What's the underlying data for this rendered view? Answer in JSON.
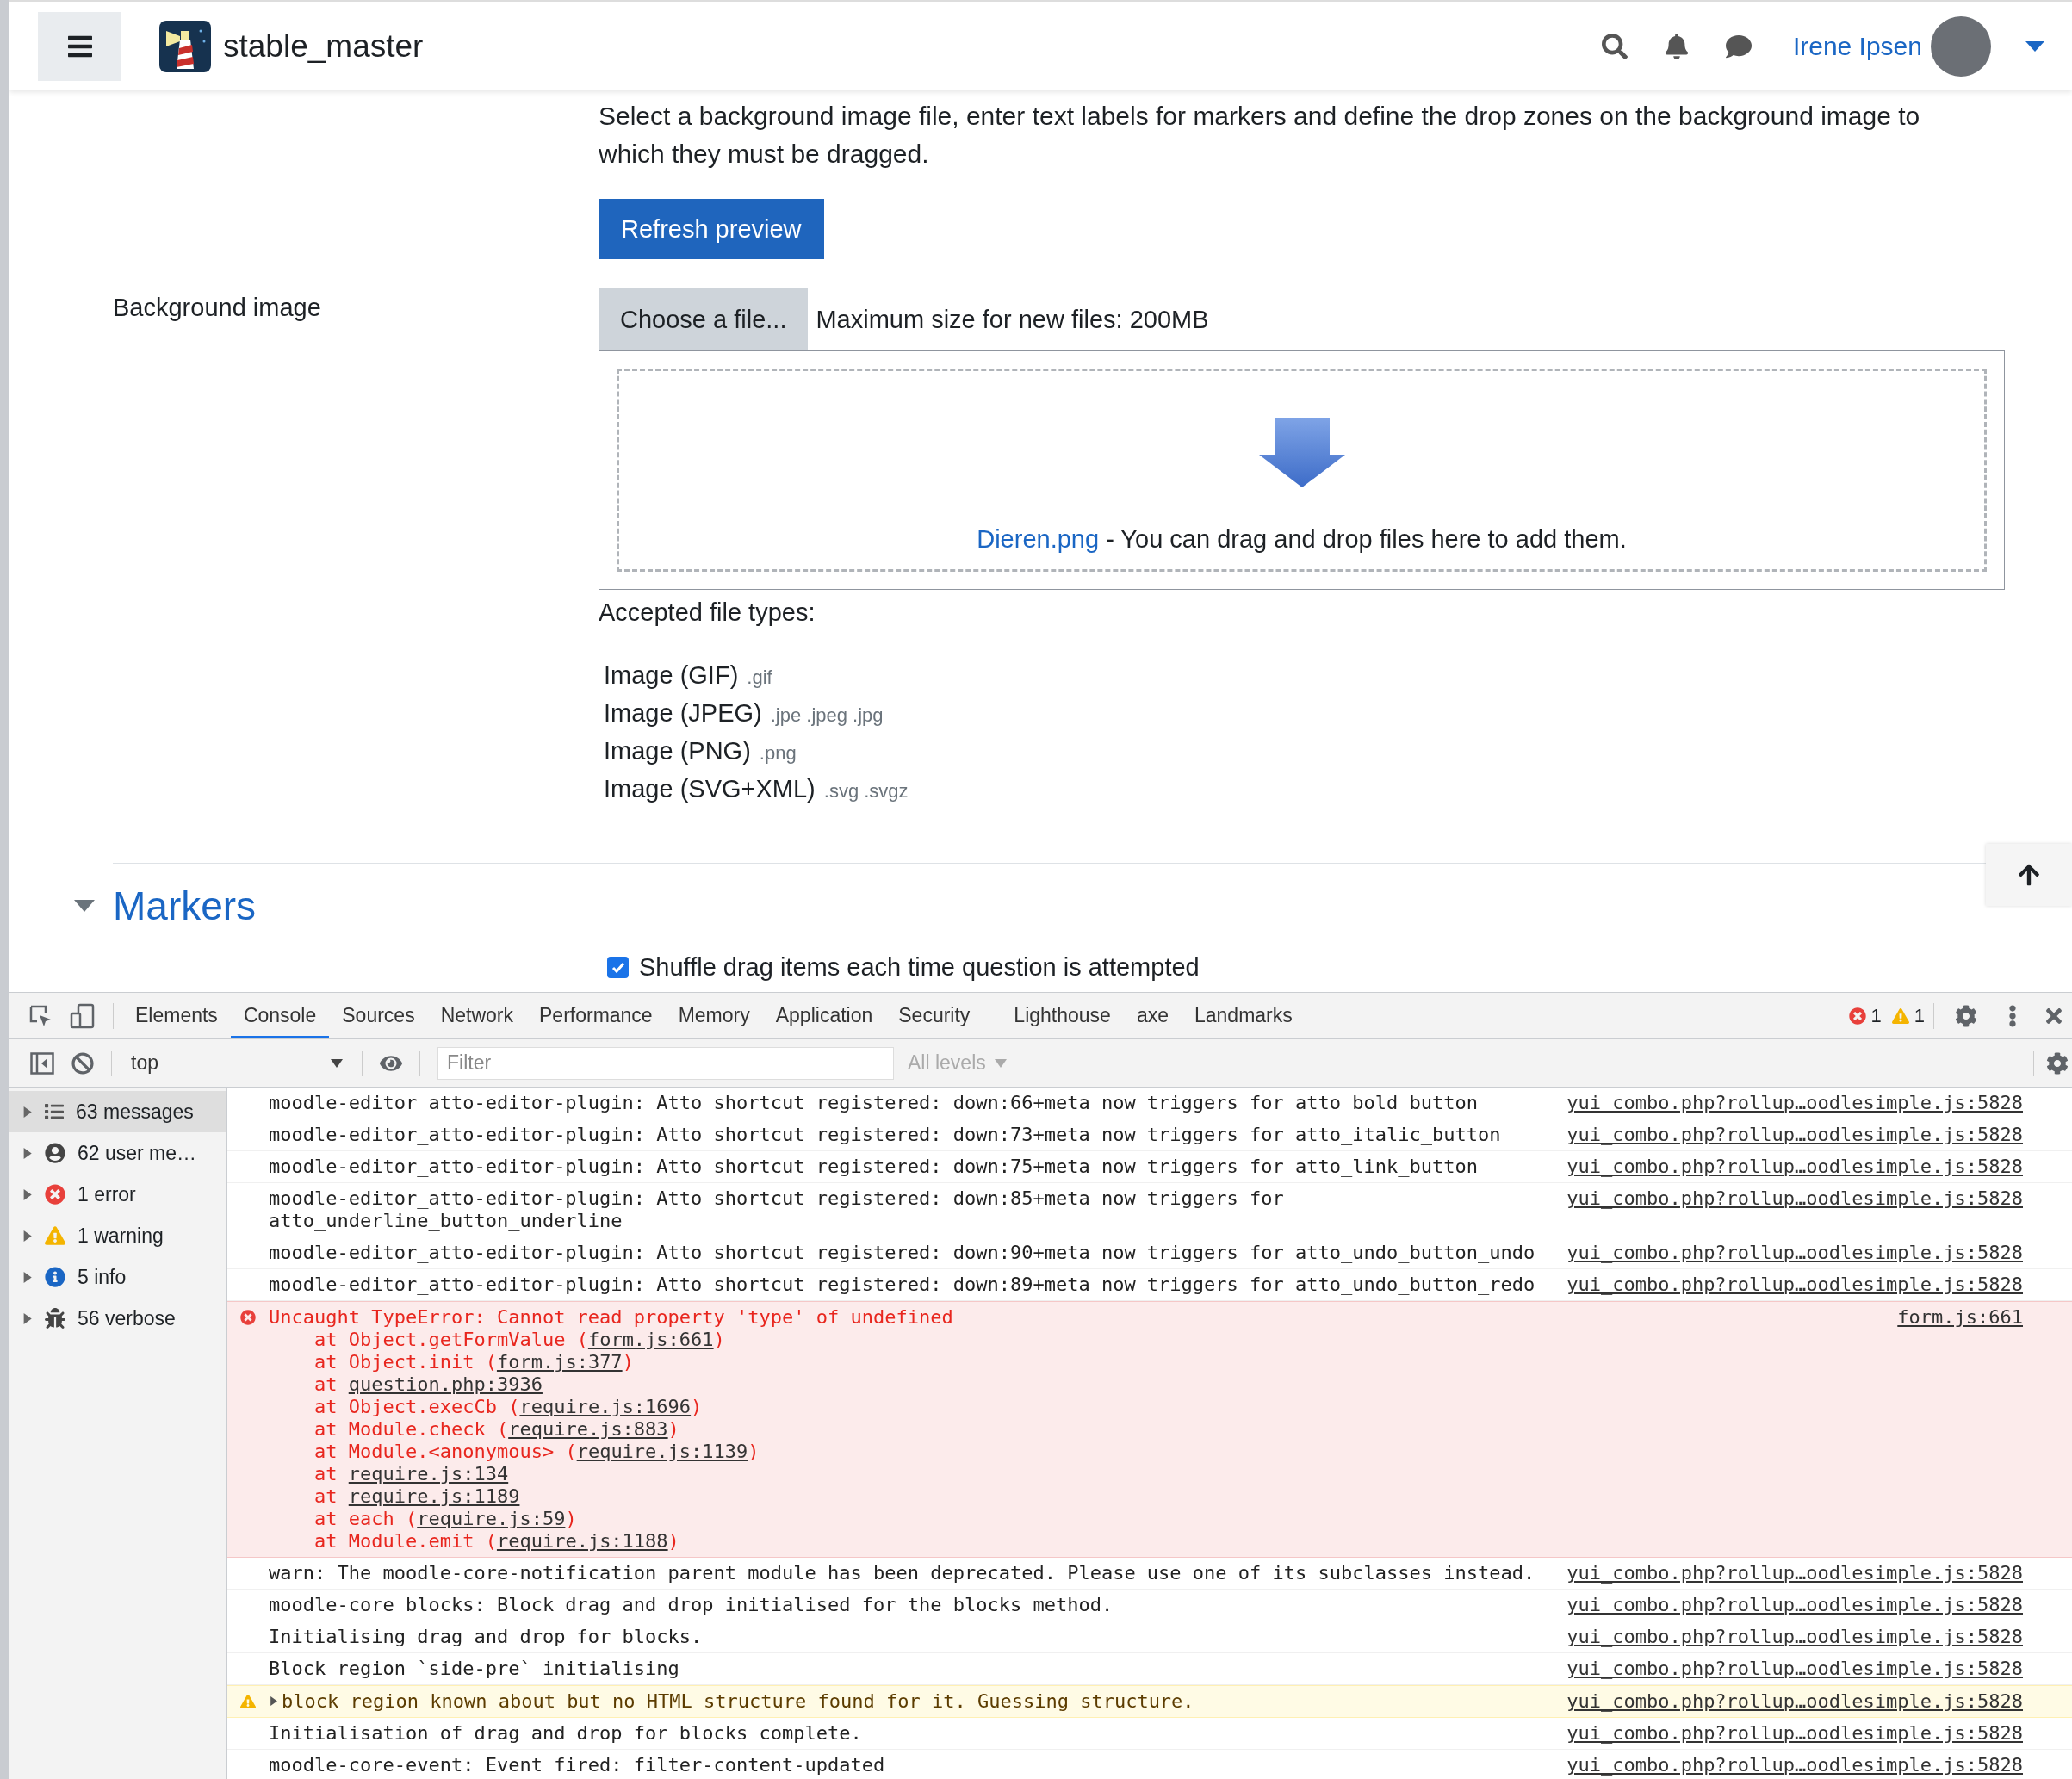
{
  "header": {
    "site_name": "stable_master",
    "user_name": "Irene Ipsen"
  },
  "form": {
    "intro": "Select a background image file, enter text labels for markers and define the drop zones on the background image to which they must be dragged.",
    "refresh_button": "Refresh preview",
    "background_image": {
      "label": "Background image",
      "choose_button": "Choose a file...",
      "max_size": "Maximum size for new files: 200MB",
      "file_link": "Dieren.png",
      "drop_hint": " - You can drag and drop files here to add them."
    },
    "accepted_label": "Accepted file types:",
    "file_types": [
      {
        "name": "Image (GIF)",
        "ext": ".gif"
      },
      {
        "name": "Image (JPEG)",
        "ext": ".jpe .jpeg .jpg"
      },
      {
        "name": "Image (PNG)",
        "ext": ".png"
      },
      {
        "name": "Image (SVG+XML)",
        "ext": ".svg .svgz"
      }
    ]
  },
  "markers": {
    "title": "Markers",
    "expanded": true,
    "shuffle": {
      "label": "Shuffle drag items each time question is attempted",
      "checked": true
    }
  },
  "devtools": {
    "tabs": [
      {
        "label": "Elements",
        "selected": false
      },
      {
        "label": "Console",
        "selected": true
      },
      {
        "label": "Sources",
        "selected": false
      },
      {
        "label": "Network",
        "selected": false
      },
      {
        "label": "Performance",
        "selected": false
      },
      {
        "label": "Memory",
        "selected": false
      },
      {
        "label": "Application",
        "selected": false
      },
      {
        "label": "Security",
        "selected": false
      },
      {
        "label": "Lighthouse",
        "selected": false
      },
      {
        "label": "axe",
        "selected": false
      },
      {
        "label": "Landmarks",
        "selected": false
      }
    ],
    "error_count": "1",
    "warning_count": "1",
    "context": "top",
    "filter_placeholder": "Filter",
    "levels": "All levels",
    "sidebar": [
      {
        "kind": "messages",
        "label": "63 messages",
        "selected": true
      },
      {
        "kind": "user",
        "label": "62 user me…",
        "selected": false
      },
      {
        "kind": "error",
        "label": "1 error",
        "selected": false
      },
      {
        "kind": "warning",
        "label": "1 warning",
        "selected": false
      },
      {
        "kind": "info",
        "label": "5 info",
        "selected": false
      },
      {
        "kind": "verbose",
        "label": "56 verbose",
        "selected": false
      }
    ],
    "messages": [
      {
        "kind": "log",
        "text": "moodle-editor_atto-editor-plugin: Atto shortcut registered: down:66+meta now triggers for atto_bold_button",
        "source": "yui_combo.php?rollup…oodlesimple.js:5828"
      },
      {
        "kind": "log",
        "text": "moodle-editor_atto-editor-plugin: Atto shortcut registered: down:73+meta now triggers for atto_italic_button",
        "source": "yui_combo.php?rollup…oodlesimple.js:5828"
      },
      {
        "kind": "log",
        "text": "moodle-editor_atto-editor-plugin: Atto shortcut registered: down:75+meta now triggers for atto_link_button",
        "source": "yui_combo.php?rollup…oodlesimple.js:5828"
      },
      {
        "kind": "log",
        "text": "moodle-editor_atto-editor-plugin: Atto shortcut registered: down:85+meta now triggers for atto_underline_button_underline",
        "source": "yui_combo.php?rollup…oodlesimple.js:5828"
      },
      {
        "kind": "log",
        "text": "moodle-editor_atto-editor-plugin: Atto shortcut registered: down:90+meta now triggers for atto_undo_button_undo",
        "source": "yui_combo.php?rollup…oodlesimple.js:5828"
      },
      {
        "kind": "log",
        "text": "moodle-editor_atto-editor-plugin: Atto shortcut registered: down:89+meta now triggers for atto_undo_button_redo",
        "source": "yui_combo.php?rollup…oodlesimple.js:5828"
      },
      {
        "kind": "error",
        "text": "Uncaught TypeError: Cannot read property 'type' of undefined",
        "source": "form.js:661",
        "stack": [
          {
            "prefix": "at Object.getFormValue (",
            "link": "form.js:661",
            "suffix": ")"
          },
          {
            "prefix": "at Object.init (",
            "link": "form.js:377",
            "suffix": ")"
          },
          {
            "prefix": "at ",
            "link": "question.php:3936"
          },
          {
            "prefix": "at Object.execCb (",
            "link": "require.js:1696",
            "suffix": ")"
          },
          {
            "prefix": "at Module.check (",
            "link": "require.js:883",
            "suffix": ")"
          },
          {
            "prefix": "at Module.<anonymous> (",
            "link": "require.js:1139",
            "suffix": ")"
          },
          {
            "prefix": "at ",
            "link": "require.js:134"
          },
          {
            "prefix": "at ",
            "link": "require.js:1189"
          },
          {
            "prefix": "at each (",
            "link": "require.js:59",
            "suffix": ")"
          },
          {
            "prefix": "at Module.emit (",
            "link": "require.js:1188",
            "suffix": ")"
          }
        ]
      },
      {
        "kind": "log",
        "text": "warn: The moodle-core-notification parent module has been deprecated. Please use one of its subclasses instead.",
        "source": "yui_combo.php?rollup…oodlesimple.js:5828"
      },
      {
        "kind": "log",
        "text": "moodle-core_blocks: Block drag and drop initialised for the blocks method.",
        "source": "yui_combo.php?rollup…oodlesimple.js:5828"
      },
      {
        "kind": "log",
        "text": "Initialising drag and drop for blocks.",
        "source": "yui_combo.php?rollup…oodlesimple.js:5828"
      },
      {
        "kind": "log",
        "text": "Block region `side-pre` initialising",
        "source": "yui_combo.php?rollup…oodlesimple.js:5828"
      },
      {
        "kind": "warning",
        "text": "block region known about but no HTML structure found for it. Guessing structure.",
        "source": "yui_combo.php?rollup…oodlesimple.js:5828"
      },
      {
        "kind": "log",
        "text": "Initialisation of drag and drop for blocks complete.",
        "source": "yui_combo.php?rollup…oodlesimple.js:5828"
      },
      {
        "kind": "log",
        "text": "moodle-core-event: Event fired: filter-content-updated",
        "source": "yui_combo.php?rollup…oodlesimple.js:5828"
      }
    ]
  }
}
